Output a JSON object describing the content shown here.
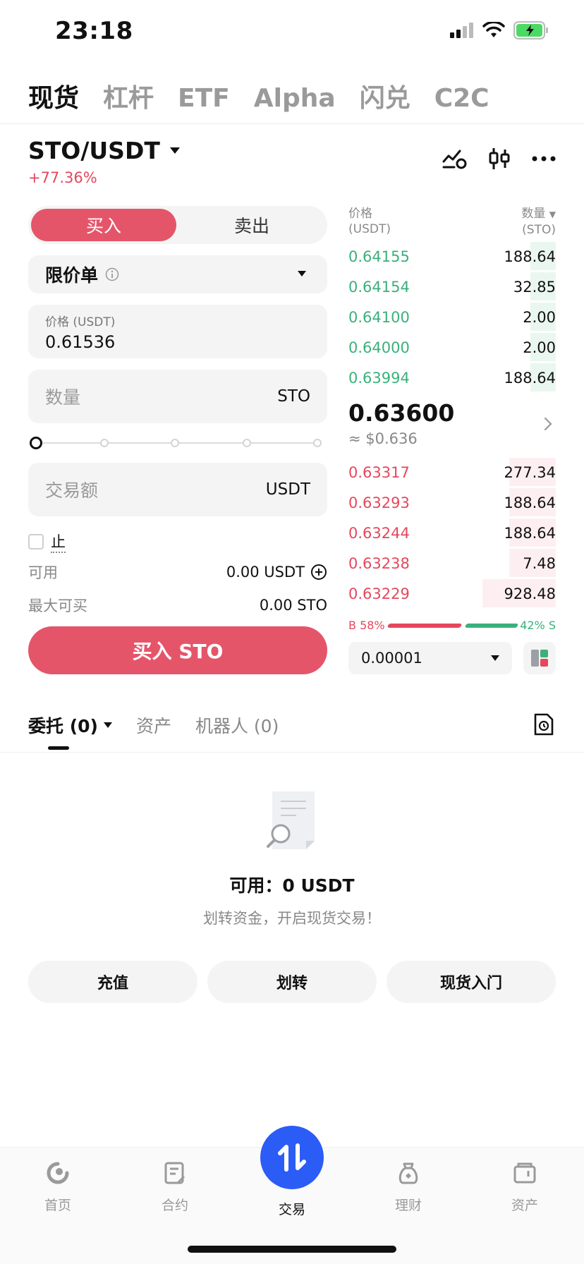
{
  "status_bar": {
    "time": "23:18"
  },
  "top_tabs": [
    "现货",
    "杠杆",
    "ETF",
    "Alpha",
    "闪兑",
    "C2C"
  ],
  "pair": {
    "symbol": "STO/USDT",
    "change": "+77.36%"
  },
  "trade_form": {
    "buy_label": "买入",
    "sell_label": "卖出",
    "order_type": "限价单",
    "price_label": "价格 (USDT)",
    "price_value": "0.61536",
    "qty_placeholder": "数量",
    "qty_unit": "STO",
    "amount_placeholder": "交易额",
    "amount_unit": "USDT",
    "stop_label": "止",
    "available_label": "可用",
    "available_value": "0.00 USDT",
    "max_buy_label": "最大可买",
    "max_buy_value": "0.00 STO",
    "submit_label": "买入 STO"
  },
  "order_book": {
    "price_header": "价格",
    "price_unit": "(USDT)",
    "qty_header": "数量",
    "qty_unit": "(STO)",
    "asks": [
      {
        "price": "0.64155",
        "qty": "188.64"
      },
      {
        "price": "0.64154",
        "qty": "32.85"
      },
      {
        "price": "0.64100",
        "qty": "2.00"
      },
      {
        "price": "0.64000",
        "qty": "2.00"
      },
      {
        "price": "0.63994",
        "qty": "188.64"
      }
    ],
    "last_price": "0.63600",
    "last_price_usd": "≈ $0.636",
    "bids": [
      {
        "price": "0.63317",
        "qty": "277.34"
      },
      {
        "price": "0.63293",
        "qty": "188.64"
      },
      {
        "price": "0.63244",
        "qty": "188.64"
      },
      {
        "price": "0.63238",
        "qty": "7.48"
      },
      {
        "price": "0.63229",
        "qty": "928.48"
      }
    ],
    "buy_ratio": "B 58%",
    "sell_ratio": "42% S",
    "precision": "0.00001"
  },
  "orders": {
    "tabs": [
      "委托 (0)",
      "资产",
      "机器人 (0)"
    ],
    "available": "可用：0 USDT",
    "hint": "划转资金，开启现货交易！",
    "actions": [
      "充值",
      "划转",
      "现货入门"
    ]
  },
  "bottom_nav": [
    "首页",
    "合约",
    "交易",
    "理财",
    "资产"
  ],
  "colors": {
    "buy": "#e5556a",
    "sell": "#3bb07b",
    "accent": "#2b5cf6"
  }
}
